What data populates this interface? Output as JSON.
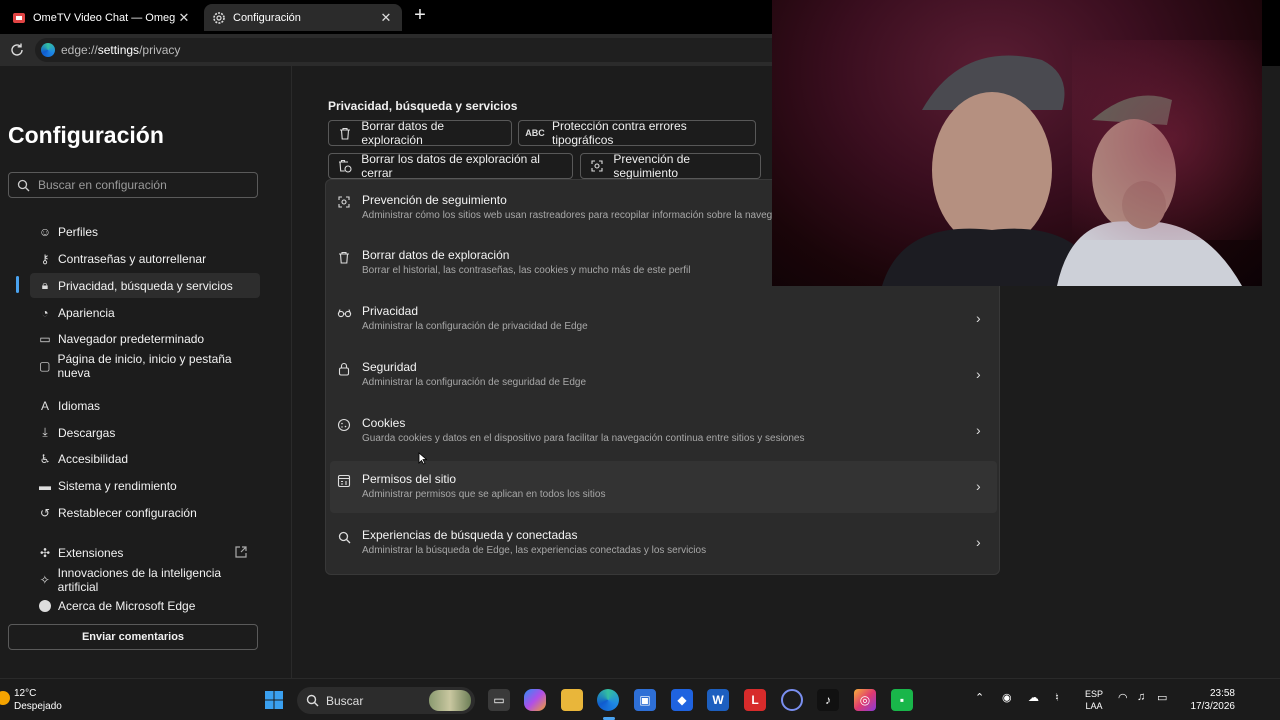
{
  "tabs": [
    {
      "title": "OmeTV Video Chat — Omegle Ra",
      "icon": "video-icon"
    },
    {
      "title": "Configuración",
      "icon": "gear-icon"
    }
  ],
  "address": {
    "scheme": "edge://",
    "host": "settings",
    "path": "/privacy"
  },
  "sidebar": {
    "title": "Configuración",
    "search_placeholder": "Buscar en configuración",
    "items": [
      {
        "label": "Perfiles",
        "icon": "profile-icon"
      },
      {
        "label": "Contraseñas y autorrellenar",
        "icon": "key-icon"
      },
      {
        "label": "Privacidad, búsqueda y servicios",
        "icon": "lock-icon"
      },
      {
        "label": "Apariencia",
        "icon": "palette-icon"
      },
      {
        "label": "Navegador predeterminado",
        "icon": "browser-icon"
      },
      {
        "label": "Página de inicio, inicio y pestaña nueva",
        "icon": "home-page-icon"
      },
      {
        "label": "Idiomas",
        "icon": "languages-icon"
      },
      {
        "label": "Descargas",
        "icon": "download-icon"
      },
      {
        "label": "Accesibilidad",
        "icon": "accessibility-icon"
      },
      {
        "label": "Sistema y rendimiento",
        "icon": "laptop-icon"
      },
      {
        "label": "Restablecer configuración",
        "icon": "reset-icon"
      },
      {
        "label": "Extensiones",
        "icon": "puzzle-icon"
      },
      {
        "label": "Innovaciones de la inteligencia artificial",
        "icon": "sparkle-icon"
      },
      {
        "label": "Acerca de Microsoft Edge",
        "icon": "edge-icon"
      }
    ],
    "feedback": "Enviar comentarios"
  },
  "main": {
    "section_title": "Privacidad, búsqueda y servicios",
    "chips": [
      {
        "label": "Borrar datos de exploración",
        "icon": "trash-icon"
      },
      {
        "label": "Protección contra errores tipográficos",
        "icon": "abc-icon"
      },
      {
        "label": "Borrar los datos de exploración al cerrar",
        "icon": "trash-clock-icon"
      },
      {
        "label": "Prevención de seguimiento",
        "icon": "tracking-icon"
      }
    ],
    "rows": [
      {
        "title": "Prevención de seguimiento",
        "desc": "Administrar cómo los sitios web usan rastreadores para recopilar información sobre la navega",
        "icon": "tracking-icon"
      },
      {
        "title": "Borrar datos de exploración",
        "desc": "Borrar el historial, las contraseñas, las cookies y mucho más de este perfil",
        "icon": "trash-icon"
      },
      {
        "title": "Privacidad",
        "desc": "Administrar la configuración de privacidad de Edge",
        "icon": "glasses-icon"
      },
      {
        "title": "Seguridad",
        "desc": "Administrar la configuración de seguridad de Edge",
        "icon": "lock-icon"
      },
      {
        "title": "Cookies",
        "desc": "Guarda cookies y datos en el dispositivo para facilitar la navegación continua entre sitios y sesiones",
        "icon": "cookie-icon"
      },
      {
        "title": "Permisos del sitio",
        "desc": "Administrar permisos que se aplican en todos los sitios",
        "icon": "site-permissions-icon"
      },
      {
        "title": "Experiencias de búsqueda y conectadas",
        "desc": "Administrar la búsqueda de Edge, las experiencias conectadas y los servicios",
        "icon": "search-icon"
      }
    ]
  },
  "taskbar": {
    "weather": {
      "temp": "12°C",
      "condition": "Despejado"
    },
    "search_label": "Buscar",
    "lang": {
      "line1": "ESP",
      "line2": "LAA"
    },
    "time": "23:58",
    "date": "17/3/2026"
  },
  "colors": {
    "accent": "#4aa3f0",
    "page_bg": "#1c1c1c",
    "card_bg": "#2b2b2b"
  }
}
